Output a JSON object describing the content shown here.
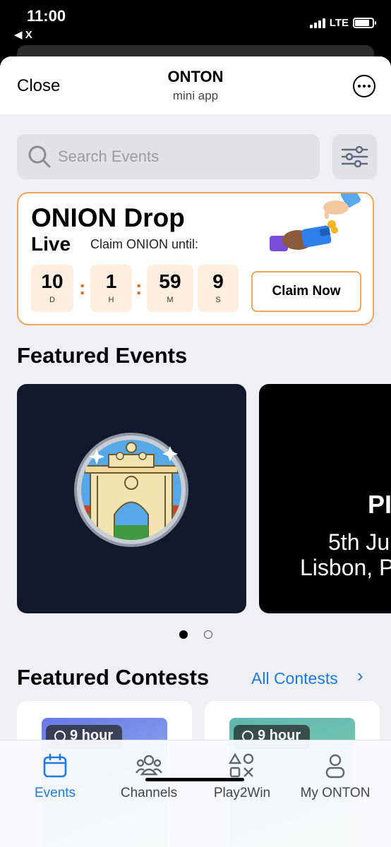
{
  "status_bar": {
    "time": "11:00",
    "back_label": "◀ X",
    "network": "LTE"
  },
  "header": {
    "close_label": "Close",
    "title": "ONTON",
    "subtitle": "mini app"
  },
  "search": {
    "placeholder": "Search Events",
    "value": ""
  },
  "onion_drop": {
    "title": "ONION Drop",
    "live_label": "Live",
    "claim_until_label": "Claim ONION until:",
    "countdown": [
      {
        "value": "10",
        "unit": "D"
      },
      {
        "value": "1",
        "unit": "H"
      },
      {
        "value": "59",
        "unit": "M"
      },
      {
        "value": "9",
        "unit": "S"
      }
    ],
    "separator": ":",
    "claim_button": "Claim Now",
    "accent_color": "#f0a55a"
  },
  "featured_events": {
    "title": "Featured Events",
    "card2": {
      "title": "PI",
      "date": "5th Ju",
      "location": "Lisbon, P"
    },
    "pagination": {
      "active_index": 0,
      "count": 2
    }
  },
  "featured_contests": {
    "title": "Featured Contests",
    "all_link": "All Contests",
    "chevron": "›",
    "cards": [
      {
        "badge": "9 hour"
      },
      {
        "badge": "9 hour"
      }
    ]
  },
  "tab_bar": {
    "active_color": "#1a7ce0",
    "tabs": [
      {
        "label": "Events",
        "icon": "calendar-icon",
        "active": true
      },
      {
        "label": "Channels",
        "icon": "people-icon",
        "active": false
      },
      {
        "label": "Play2Win",
        "icon": "shapes-icon",
        "active": false
      },
      {
        "label": "My ONTON",
        "icon": "person-icon",
        "active": false
      }
    ]
  }
}
